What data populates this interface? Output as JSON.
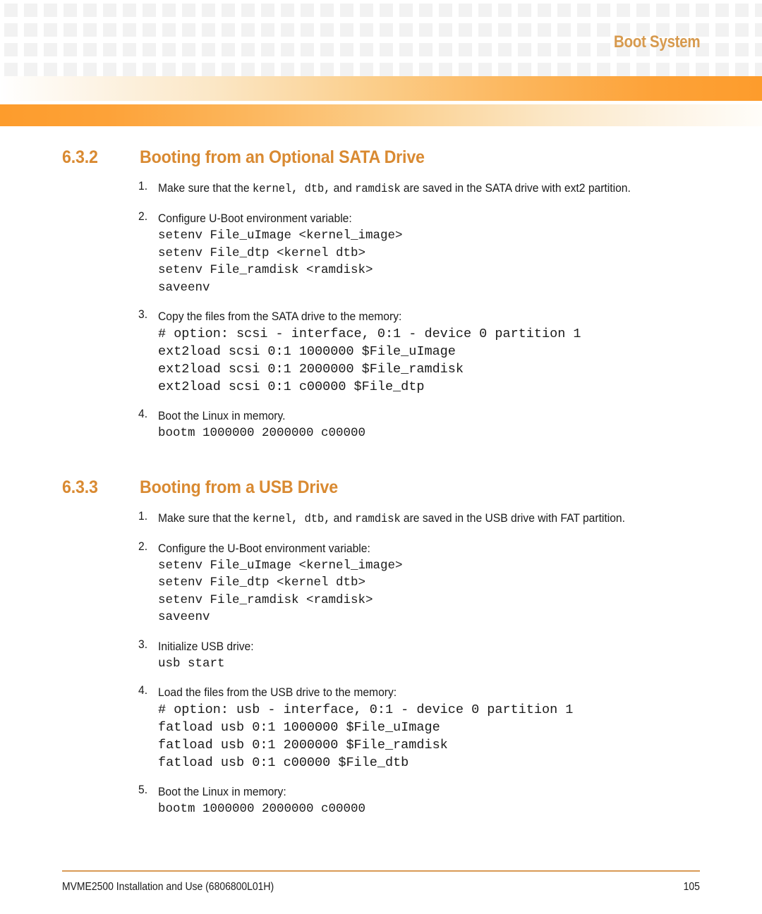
{
  "header": {
    "running_title": "Boot System",
    "title_color": "#d79a4e",
    "band_color": "#fd9c2c"
  },
  "sections": [
    {
      "number": "6.3.2",
      "title": "Booting from an Optional SATA Drive",
      "steps": [
        {
          "num": "1.",
          "text_html": "Make sure that the <span class=\"mono\">kernel, dtb,</span> and <span class=\"mono\">ramdisk</span> are saved in the SATA drive with ext2 partition.",
          "code": ""
        },
        {
          "num": "2.",
          "text_html": "Configure U-Boot environment variable:",
          "code": "setenv File_uImage <kernel_image>\nsetenv File_dtp <kernel dtb>\nsetenv File_ramdisk <ramdisk>\nsaveenv"
        },
        {
          "num": "3.",
          "text_html": "Copy the files from the SATA drive to the memory:",
          "code": "# option: scsi - interface, 0:1 - device 0 partition 1\next2load scsi 0:1 1000000 $File_uImage\next2load scsi 0:1 2000000 $File_ramdisk\next2load scsi 0:1 c00000 $File_dtp"
        },
        {
          "num": "4.",
          "text_html": "Boot the Linux in memory.",
          "code": "bootm 1000000 2000000 c00000"
        }
      ]
    },
    {
      "number": "6.3.3",
      "title": "Booting from a USB Drive",
      "steps": [
        {
          "num": "1.",
          "text_html": "Make sure that the <span class=\"mono\">kernel, dtb,</span> and <span class=\"mono\">ramdisk</span> are saved in the USB drive with FAT partition.",
          "code": ""
        },
        {
          "num": "2.",
          "text_html": "Configure the U-Boot environment variable:",
          "code": "setenv File_uImage <kernel_image>\nsetenv File_dtp <kernel dtb>\nsetenv File_ramdisk <ramdisk>\nsaveenv"
        },
        {
          "num": "3.",
          "text_html": "Initialize USB drive:",
          "code": "usb start"
        },
        {
          "num": "4.",
          "text_html": "Load the files from the USB drive to the memory:",
          "code": "# option: usb - interface, 0:1 - device 0 partition 1\nfatload usb 0:1 1000000 $File_uImage\nfatload usb 0:1 2000000 $File_ramdisk\nfatload usb 0:1 c00000 $File_dtb"
        },
        {
          "num": "5.",
          "text_html": "Boot the Linux in memory:",
          "code": "bootm 1000000 2000000 c00000"
        }
      ]
    }
  ],
  "footer": {
    "document": "MVME2500 Installation and Use (6806800L01H)",
    "page_number": "105",
    "rule_color": "#d99a56"
  }
}
